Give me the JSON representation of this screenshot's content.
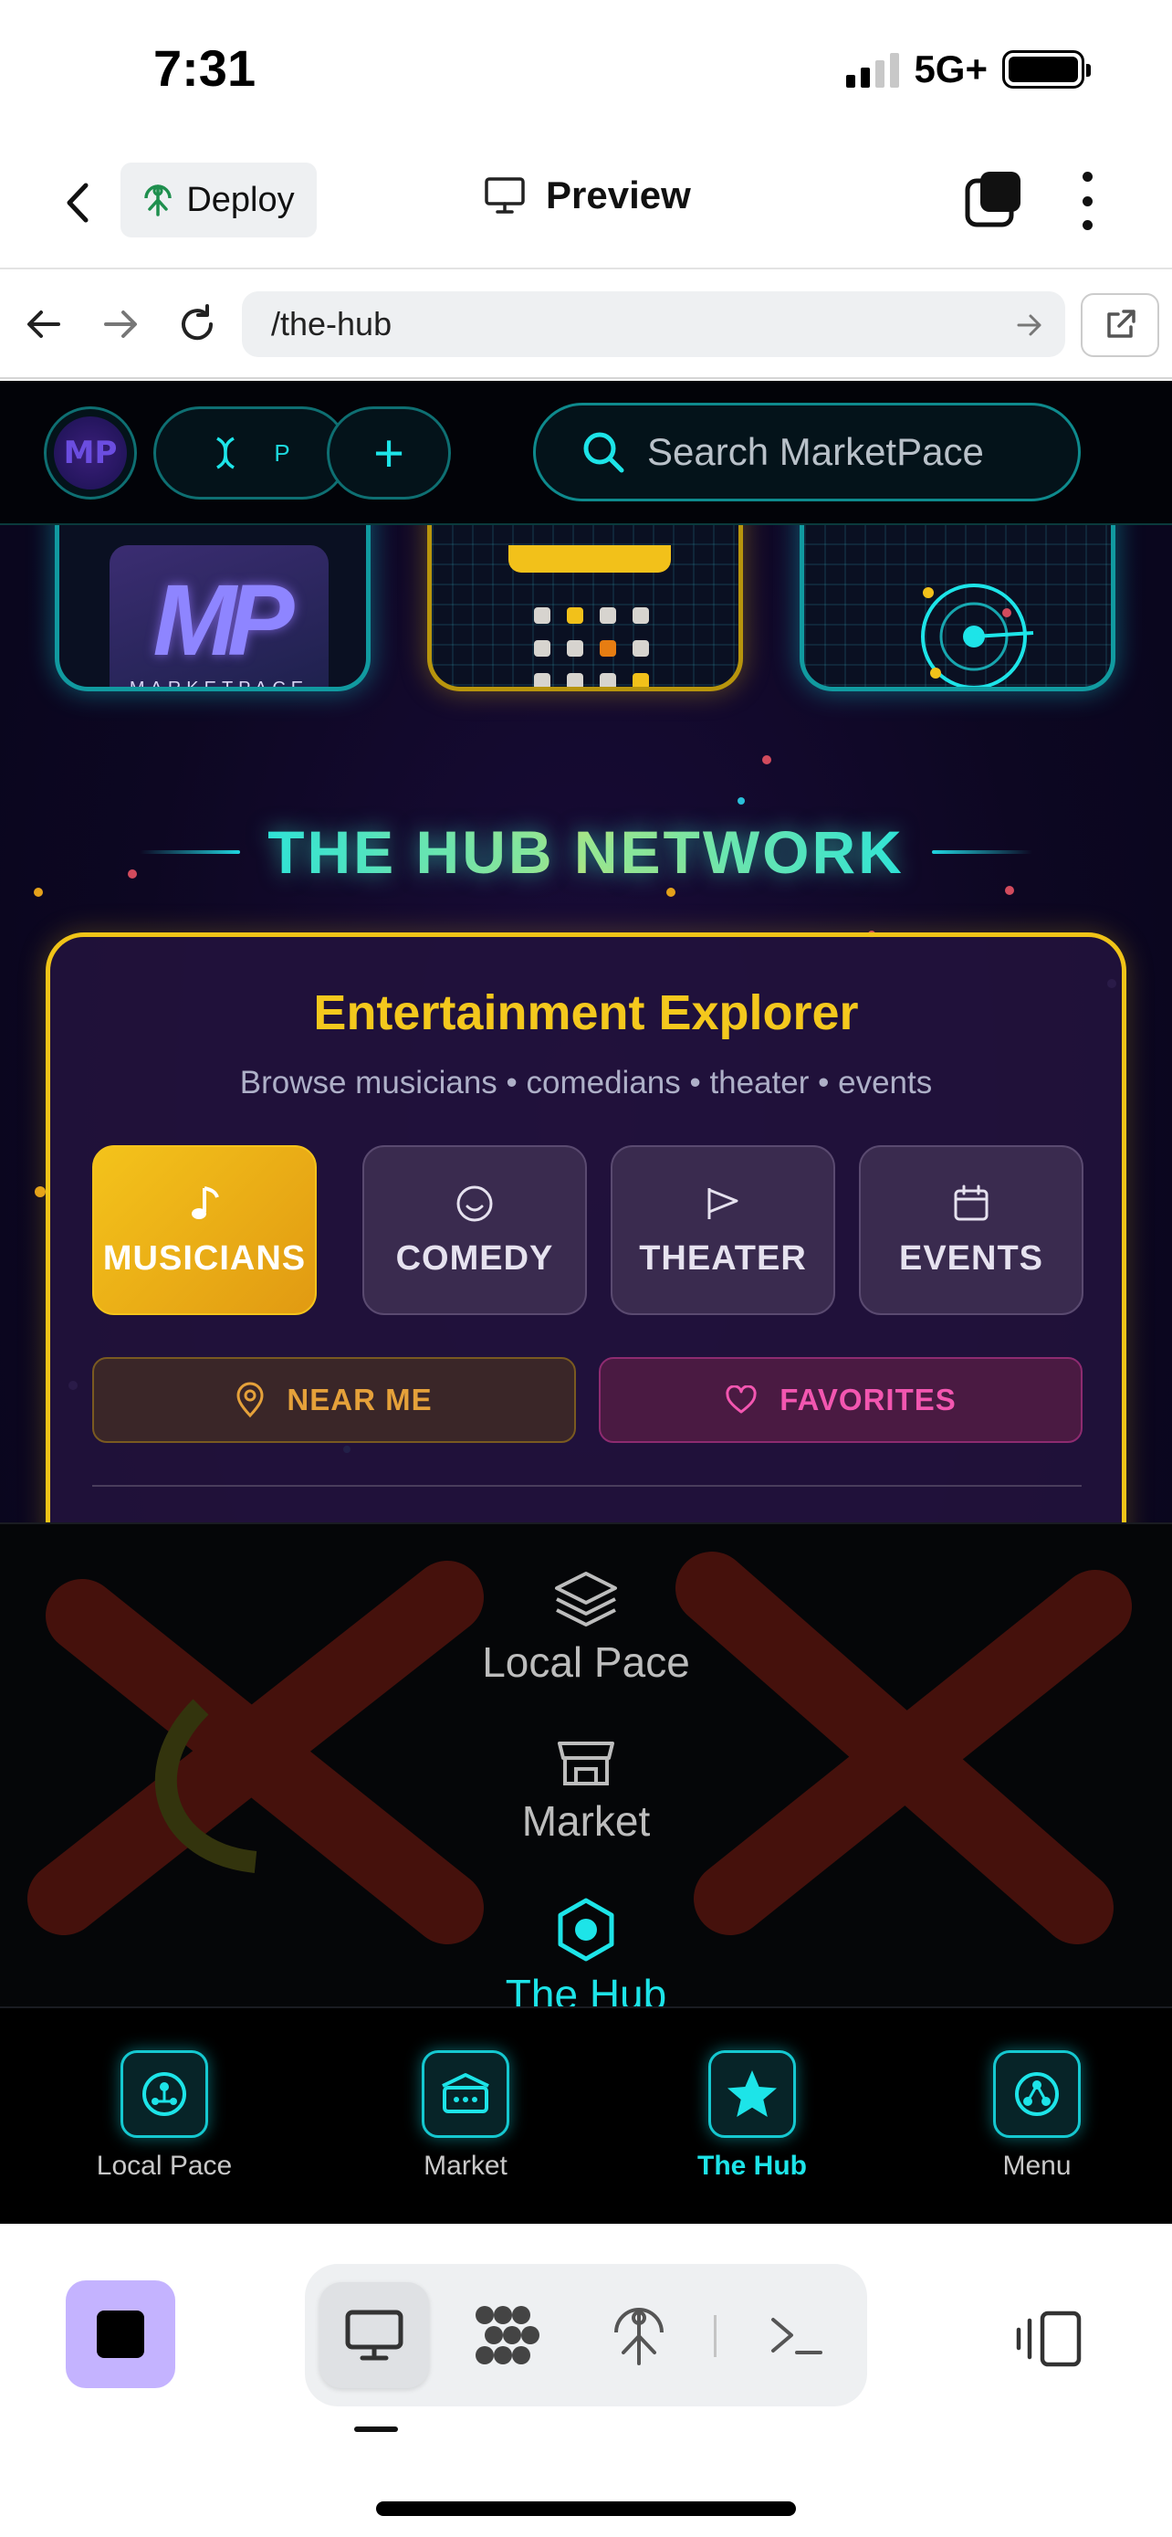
{
  "status_bar": {
    "time": "7:31",
    "network": "5G+"
  },
  "app_bar": {
    "deploy_label": "Deploy",
    "preview_label": "Preview"
  },
  "url_bar": {
    "url": "/the-hub"
  },
  "app_header": {
    "logo_text": "MP",
    "dna_label": "P",
    "plus_label": "+",
    "search_placeholder": "Search MarketPace"
  },
  "feature_cards": {
    "logo_word": "MARKETPACE",
    "logo_mark": "MP"
  },
  "hub": {
    "title": "THE HUB NETWORK"
  },
  "explorer": {
    "title": "Entertainment Explorer",
    "subtitle": "Browse musicians • comedians • theater • events",
    "categories": [
      {
        "label": "MUSICIANS",
        "icon": "music-note-icon",
        "active": true
      },
      {
        "label": "COMEDY",
        "icon": "smiley-icon",
        "active": false
      },
      {
        "label": "THEATER",
        "icon": "flag-icon",
        "active": false
      },
      {
        "label": "EVENTS",
        "icon": "calendar-icon",
        "active": false
      }
    ],
    "filters": {
      "near_me": "NEAR ME",
      "favorites": "FAVORITES"
    }
  },
  "drawer": {
    "items": [
      {
        "label": "Local Pace",
        "icon": "layers-icon"
      },
      {
        "label": "Market",
        "icon": "market-stall-icon"
      },
      {
        "label": "The Hub",
        "icon": "hub-icon",
        "active": true
      }
    ]
  },
  "tabbar": {
    "items": [
      {
        "label": "Local Pace",
        "icon": "local-pace-icon"
      },
      {
        "label": "Market",
        "icon": "market-icon"
      },
      {
        "label": "The Hub",
        "icon": "star-icon",
        "active": true
      },
      {
        "label": "Menu",
        "icon": "menu-network-icon"
      }
    ]
  },
  "colors": {
    "accent_cyan": "#1de4e8",
    "accent_gold": "#f4c81d",
    "accent_pink": "#f256b0",
    "background": "#0d0722"
  }
}
